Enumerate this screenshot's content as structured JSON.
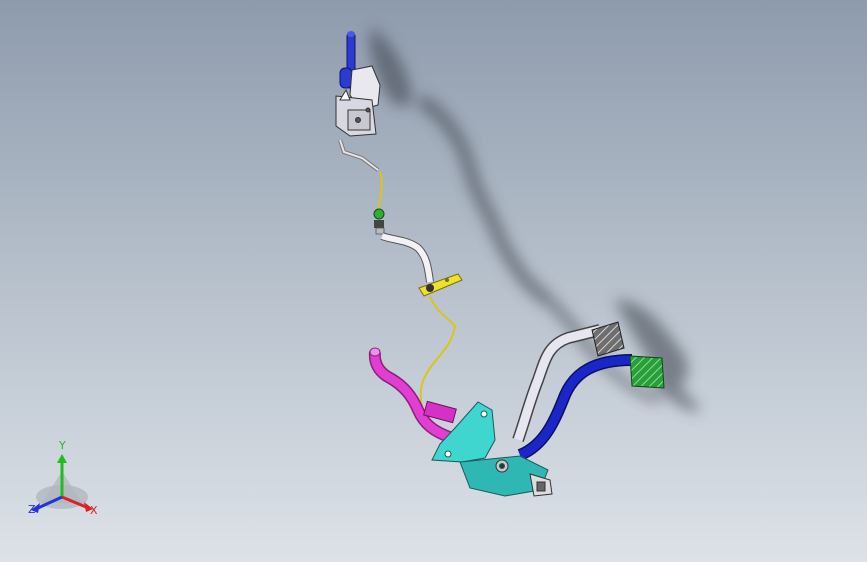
{
  "viewport": {
    "background_top": "#8e9bad",
    "background_bottom": "#dde2e8"
  },
  "model": {
    "parts": [
      {
        "name": "shift-lever-top",
        "color": "#2b3bd0"
      },
      {
        "name": "upper-bracket",
        "color": "#e8e8ee"
      },
      {
        "name": "linkage-rod",
        "color": "#dcdce4"
      },
      {
        "name": "yellow-cable",
        "color": "#e6d21a"
      },
      {
        "name": "cable-connector",
        "color": "#2fae33"
      },
      {
        "name": "mounting-plate",
        "color": "#efe12a"
      },
      {
        "name": "magenta-pipe",
        "color": "#e23ed2"
      },
      {
        "name": "pedal-bracket",
        "color": "#3fd6d0"
      },
      {
        "name": "white-pedal-arm",
        "color": "#e6e6f0"
      },
      {
        "name": "blue-pedal-arm",
        "color": "#1b26c8"
      },
      {
        "name": "gray-pedal-pad",
        "color": "#5a5a5a"
      },
      {
        "name": "green-pedal-pad",
        "color": "#34b94a"
      },
      {
        "name": "shadow",
        "color": "#3a3f4a"
      }
    ]
  },
  "triad": {
    "labels": {
      "y": "Y",
      "x": "X",
      "z": "Z"
    },
    "colors": {
      "y": "#22bb22",
      "x": "#dd2222",
      "z": "#2233dd"
    }
  }
}
